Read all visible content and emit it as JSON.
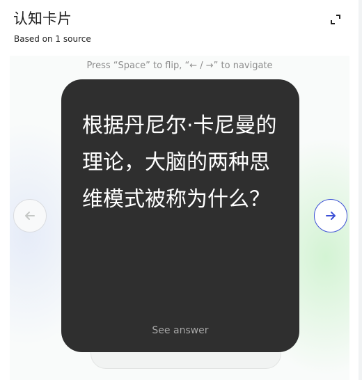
{
  "header": {
    "title": "认知卡片",
    "subtitle": "Based on 1 source",
    "expand_icon": "expand-icon"
  },
  "flashcard": {
    "hint": "Press “Space” to flip, “← / →” to navigate",
    "question": "根据丹尼尔·卡尼曼的理论，大脑的两种思维模式被称为什么？",
    "see_answer": "See answer"
  },
  "navigation": {
    "prev_icon": "arrow-left-icon",
    "next_icon": "arrow-right-icon",
    "prev_enabled": false,
    "next_enabled": true,
    "accent_color": "#3c4fd6",
    "disabled_color": "#c4c7c5"
  },
  "colors": {
    "card_background": "#2f2f2f",
    "card_text": "#ffffff"
  }
}
